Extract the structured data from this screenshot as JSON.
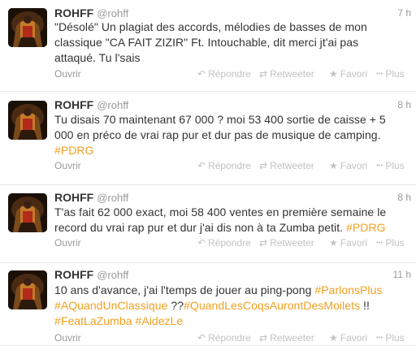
{
  "tweets": [
    {
      "name": "ROHFF",
      "handle": "@rohff",
      "time": "7 h",
      "segments": [
        {
          "t": "\"Désolé\" Un plagiat des accords, mélodies de basses de mon"
        },
        {
          "t": "\n"
        },
        {
          "t": "classique \"CA FAIT ZIZIR\" Ft. Intouchable, dit merci jt'ai pas"
        },
        {
          "t": "\n"
        },
        {
          "t": "attaqué. Tu l'sais"
        }
      ]
    },
    {
      "name": "ROHFF",
      "handle": "@rohff",
      "time": "8 h",
      "segments": [
        {
          "t": "Tu disais 70 maintenant 67 000 ? moi 53 400 sortie de caisse + 5"
        },
        {
          "t": "\n"
        },
        {
          "t": "000 en préco de vrai rap pur et dur pas de musique de camping."
        },
        {
          "t": "\n"
        },
        {
          "t": "#PDRG",
          "tag": true
        }
      ]
    },
    {
      "name": "ROHFF",
      "handle": "@rohff",
      "time": "8 h",
      "segments": [
        {
          "t": "T'as fait 62 000 exact, moi 58 400 ventes en première semaine le"
        },
        {
          "t": "\n"
        },
        {
          "t": "record du vrai rap pur et dur j'ai dis non à ta Zumba petit. "
        },
        {
          "t": "#PDRG",
          "tag": true
        }
      ]
    },
    {
      "name": "ROHFF",
      "handle": "@rohff",
      "time": "11 h",
      "segments": [
        {
          "t": "10 ans d'avance, j'ai l'temps de jouer au ping-pong "
        },
        {
          "t": "#ParlonsPlus",
          "tag": true
        },
        {
          "t": "\n"
        },
        {
          "t": "#AQuandUnClassique",
          "tag": true
        },
        {
          "t": " ??"
        },
        {
          "t": "#QuandLesCoqsAurontDesMoilets",
          "tag": true
        },
        {
          "t": " !!"
        },
        {
          "t": "\n"
        },
        {
          "t": "#FeatLaZumba",
          "tag": true
        },
        {
          "t": " "
        },
        {
          "t": "#AidezLe",
          "tag": true
        }
      ]
    }
  ],
  "actions": {
    "expand": "Ouvrir",
    "reply": "Répondre",
    "retweet": "Retweeter",
    "favorite": "Favori",
    "more": "Plus",
    "icons": {
      "reply": "reply-icon",
      "retweet": "retweet-icon",
      "favorite": "star-icon",
      "more": "more-icon"
    }
  },
  "colors": {
    "hashtag": "#f0a020",
    "text": "#333333",
    "muted": "#999999"
  }
}
